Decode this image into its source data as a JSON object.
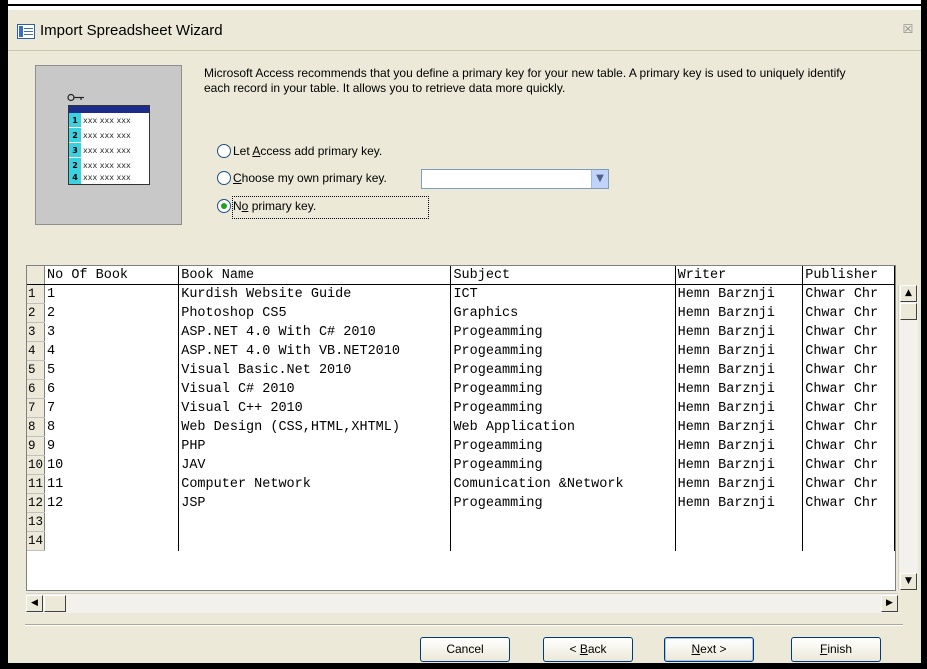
{
  "window": {
    "title": "Import Spreadsheet Wizard",
    "close_glyph": "☒"
  },
  "illustration": {
    "rows": [
      {
        "num": "1",
        "text": "xxx xxx xxx"
      },
      {
        "num": "2",
        "text": "xxx xxx xxx"
      },
      {
        "num": "3",
        "text": "xxx xxx xxx"
      },
      {
        "num": "2",
        "text": "xxx xxx xxx"
      },
      {
        "num": "4",
        "text": "xxx xxx xxx"
      }
    ]
  },
  "description": "Microsoft Access recommends that you define a primary key for your new table. A primary key is used to uniquely identify each record in your table. It allows you to retrieve data more quickly.",
  "options": {
    "let_access_pre": "Let ",
    "let_access_accel": "A",
    "let_access_post": "ccess add primary key.",
    "choose_accel": "C",
    "choose_post": "hoose my own primary key.",
    "no_pre": "N",
    "no_accel": "o",
    "no_post": " primary key.",
    "selected": "no_primary_key",
    "combo_value": ""
  },
  "grid": {
    "columns": [
      "No Of Book",
      "Book Name",
      "Subject",
      "Writer",
      "Publisher"
    ],
    "rows": [
      {
        "n": "1",
        "cells": [
          "1",
          "Kurdish Website Guide",
          "ICT",
          "Hemn Barznji",
          "Chwar Chr"
        ]
      },
      {
        "n": "2",
        "cells": [
          "2",
          "Photoshop CS5",
          "Graphics",
          "Hemn Barznji",
          "Chwar Chr"
        ]
      },
      {
        "n": "3",
        "cells": [
          "3",
          "ASP.NET 4.0 With C# 2010",
          "Progeamming",
          "Hemn Barznji",
          "Chwar Chr"
        ]
      },
      {
        "n": "4",
        "cells": [
          "4",
          "ASP.NET 4.0 With VB.NET2010",
          "Progeamming",
          "Hemn Barznji",
          "Chwar Chr"
        ]
      },
      {
        "n": "5",
        "cells": [
          "5",
          "Visual Basic.Net 2010",
          "Progeamming",
          "Hemn Barznji",
          "Chwar Chr"
        ]
      },
      {
        "n": "6",
        "cells": [
          "6",
          "Visual C#  2010",
          "Progeamming",
          "Hemn Barznji",
          "Chwar Chr"
        ]
      },
      {
        "n": "7",
        "cells": [
          "7",
          "Visual C++ 2010",
          "Progeamming",
          "Hemn Barznji",
          "Chwar Chr"
        ]
      },
      {
        "n": "8",
        "cells": [
          "8",
          "Web Design (CSS,HTML,XHTML)",
          "Web Application",
          "Hemn Barznji",
          "Chwar Chr"
        ]
      },
      {
        "n": "9",
        "cells": [
          "9",
          "PHP",
          "Progeamming",
          "Hemn Barznji",
          "Chwar Chr"
        ]
      },
      {
        "n": "10",
        "cells": [
          "10",
          "JAV",
          "Progeamming",
          "Hemn Barznji",
          "Chwar Chr"
        ]
      },
      {
        "n": "11",
        "cells": [
          "11",
          "Computer Network",
          "Comunication &Network",
          "Hemn Barznji",
          "Chwar Chr"
        ]
      },
      {
        "n": "12",
        "cells": [
          "12",
          "JSP",
          "Progeamming",
          "Hemn Barznji",
          "Chwar Chr"
        ]
      },
      {
        "n": "13",
        "cells": [
          "",
          "",
          "",
          "",
          ""
        ]
      },
      {
        "n": "14",
        "cells": [
          "",
          "",
          "",
          "",
          ""
        ]
      }
    ]
  },
  "buttons": {
    "cancel": "Cancel",
    "back_pre": "< ",
    "back_accel": "B",
    "back_post": "ack",
    "next_accel": "N",
    "next_post": "ext >",
    "finish_accel": "F",
    "finish_post": "inish"
  },
  "colors": {
    "dialog_bg": "#ece9d8",
    "radio_selected": "#21a121",
    "button_border": "#003c74"
  }
}
